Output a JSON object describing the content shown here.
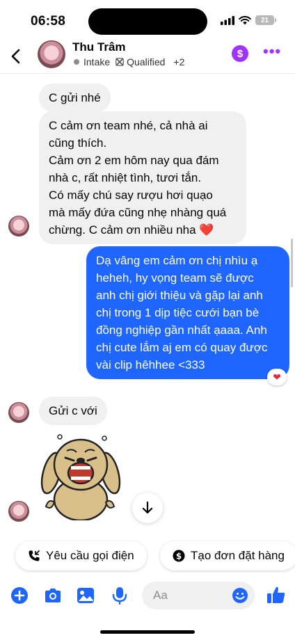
{
  "status_bar": {
    "time": "06:58",
    "battery": "21"
  },
  "header": {
    "contact_name": "Thu Trâm",
    "tag_1": "Intake",
    "tag_2": "Qualified",
    "extra_tags": "+2",
    "dollar_symbol": "$",
    "more_symbol": "•••"
  },
  "messages": {
    "m1": "C gửi nhé",
    "m2_lines": [
      "C cảm ơn team nhé, cả nhà ai",
      "cũng thích.",
      "Cảm ơn 2 em hôm nay qua đám",
      "nhà c, rất nhiệt tình, tươi tắn.",
      "Có mấy chú say rượu hơi quạo",
      "mà mấy đứa cũng nhẹ nhàng quá",
      "chừng. C cảm ơn nhiều nha ❤️"
    ],
    "m3_lines": [
      "Dạ vâng em cảm ơn chị nhìu ạ",
      "heheh, hy vọng team sẽ được",
      "anh chị giới thiệu và gặp lại anh",
      "chị trong 1 dịp tiệc cưới bạn bè",
      "đồng nghiệp gần nhất ạaaa. Anh",
      "chị cute lắm aj em có quay được",
      "vài clip hêhhee <333"
    ],
    "m3_reaction": "❤",
    "m4": "Gửi c với"
  },
  "quick_actions": {
    "call_request": "Yêu cầu gọi điện",
    "create_order": "Tạo đơn đặt hàng"
  },
  "composer": {
    "placeholder": "Aa"
  },
  "colors": {
    "accent_blue": "#1e66ff",
    "purple": "#a033ff",
    "incoming_bubble": "#f0f0f0"
  }
}
